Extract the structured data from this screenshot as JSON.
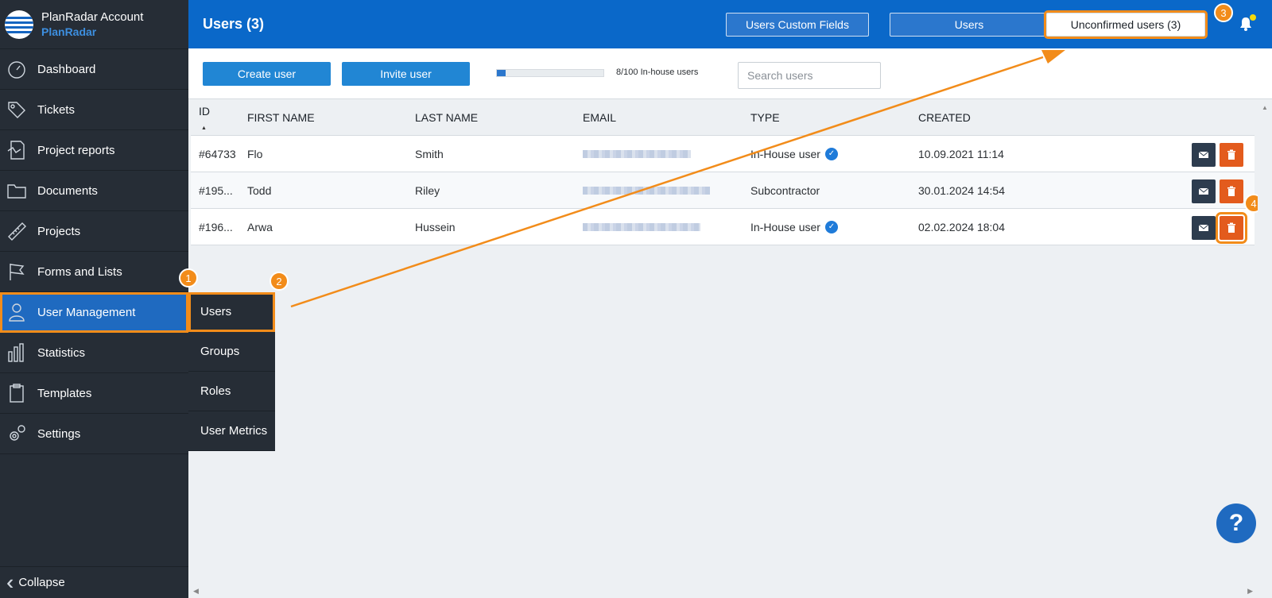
{
  "brand": {
    "account": "PlanRadar Account",
    "name": "PlanRadar"
  },
  "sidebar": {
    "items": [
      {
        "label": "Dashboard",
        "icon": "dashboard-icon"
      },
      {
        "label": "Tickets",
        "icon": "ticket-icon"
      },
      {
        "label": "Project reports",
        "icon": "report-icon"
      },
      {
        "label": "Documents",
        "icon": "folder-icon"
      },
      {
        "label": "Projects",
        "icon": "ruler-icon"
      },
      {
        "label": "Forms and Lists",
        "icon": "flag-icon"
      },
      {
        "label": "User Management",
        "icon": "user-icon",
        "active": true
      },
      {
        "label": "Statistics",
        "icon": "bar-chart-icon"
      },
      {
        "label": "Templates",
        "icon": "clipboard-icon"
      },
      {
        "label": "Settings",
        "icon": "gear-icon"
      }
    ],
    "collapse": "Collapse"
  },
  "submenu": {
    "items": [
      {
        "label": "Users",
        "active": true
      },
      {
        "label": "Groups"
      },
      {
        "label": "Roles"
      },
      {
        "label": "User Metrics"
      }
    ]
  },
  "header": {
    "title": "Users (3)",
    "custom_fields": "Users Custom Fields",
    "users": "Users",
    "unconfirmed": "Unconfirmed users (3)"
  },
  "toolbar": {
    "create": "Create user",
    "invite": "Invite user",
    "progress_label": "8/100 In-house users",
    "progress_fraction": 0.08,
    "search_placeholder": "Search users"
  },
  "table": {
    "columns": [
      "ID",
      "FIRST NAME",
      "LAST NAME",
      "EMAIL",
      "TYPE",
      "CREATED"
    ],
    "rows": [
      {
        "id": "#64733",
        "first": "Flo",
        "last": "Smith",
        "type": "In-House user",
        "verified": true,
        "created": "10.09.2021 11:14"
      },
      {
        "id": "#195...",
        "first": "Todd",
        "last": "Riley",
        "type": "Subcontractor",
        "verified": false,
        "created": "30.01.2024 14:54"
      },
      {
        "id": "#196...",
        "first": "Arwa",
        "last": "Hussein",
        "type": "In-House user",
        "verified": true,
        "created": "02.02.2024 18:04"
      }
    ]
  },
  "badges": [
    "1",
    "2",
    "3",
    "4"
  ],
  "help": "?",
  "colors": {
    "accent": "#0a68c9",
    "highlight": "#f28c1a",
    "delete": "#e35b1d",
    "sidebar": "#262d36"
  }
}
